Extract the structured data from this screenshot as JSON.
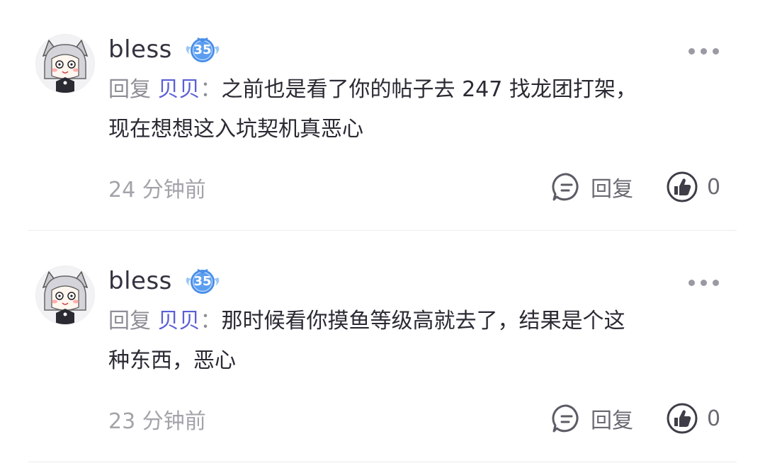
{
  "comments": [
    {
      "username": "bless",
      "level": "35",
      "reply_prefix": "回复",
      "reply_target": "贝贝",
      "colon": "：",
      "text_line1": "之前也是看了你的帖子去 247 找龙团打架，",
      "text_line2": "现在想想这入坑契机真恶心",
      "timestamp": "24 分钟前",
      "reply_label": "回复",
      "like_count": "0"
    },
    {
      "username": "bless",
      "level": "35",
      "reply_prefix": "回复",
      "reply_target": "贝贝",
      "colon": "：",
      "text_line1": "那时候看你摸鱼等级高就去了，结果是个这",
      "text_line2": "种东西，恶心",
      "timestamp": "23 分钟前",
      "reply_label": "回复",
      "like_count": "0"
    }
  ],
  "icons": {
    "more": "more-dots-icon",
    "reply": "comment-bubble-icon",
    "like": "thumbs-up-icon",
    "badge": "level-badge-icon"
  },
  "colors": {
    "reply_target": "#5a5fd6",
    "badge": "#4a8ee8"
  }
}
